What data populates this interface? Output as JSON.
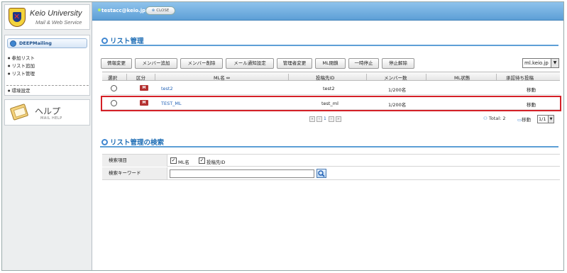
{
  "brand": {
    "title": "Keio University",
    "subtitle": "Mail & Web Service"
  },
  "header": {
    "user_email": "testacc@keio.jp",
    "close_label": "CLOSE"
  },
  "sidebar": {
    "section_title": "DEEPMailing",
    "items": [
      {
        "label": "参加リスト"
      },
      {
        "label": "リスト追加"
      },
      {
        "label": "リスト管理"
      },
      {
        "label": "環境設定"
      }
    ],
    "help": {
      "title": "ヘルプ",
      "subtitle": "MAIL HELP"
    }
  },
  "list_section": {
    "title": "リスト管理",
    "toolbar": [
      {
        "label": "情報変更"
      },
      {
        "label": "メンバー追加"
      },
      {
        "label": "メンバー削除"
      },
      {
        "label": "メール通知設定"
      },
      {
        "label": "管理者変更"
      },
      {
        "label": "ML閉鎖"
      },
      {
        "label": "一時停止"
      },
      {
        "label": "停止解除"
      }
    ],
    "domain_select": "ml.keio.jp",
    "columns": {
      "select": "選択",
      "kind": "区分",
      "ml_name": "ML名 ⇔",
      "post_id": "投稿先ID",
      "member_count": "メンバー数",
      "ml_status": "ML状態",
      "approval": "承認待ち投稿"
    },
    "rows": [
      {
        "kind": "M",
        "ml_name": "test2",
        "post_id": "test2",
        "member_count": "1/200名",
        "ml_status": "",
        "approval": "移動"
      },
      {
        "kind": "M",
        "ml_name": "TEST_ML",
        "post_id": "test_ml",
        "member_count": "1/200名",
        "ml_status": "",
        "approval": "移動"
      }
    ],
    "pager": {
      "current_page": "1",
      "total_label": "Total: 2",
      "move_label": "移動",
      "page_select": "1/1"
    }
  },
  "search_section": {
    "title": "リスト管理の検索",
    "fields": {
      "item_label": "検索項目",
      "option_ml_name": "ML名",
      "option_post_id": "投稿先ID",
      "keyword_label": "検索キーワード",
      "keyword_value": ""
    }
  }
}
